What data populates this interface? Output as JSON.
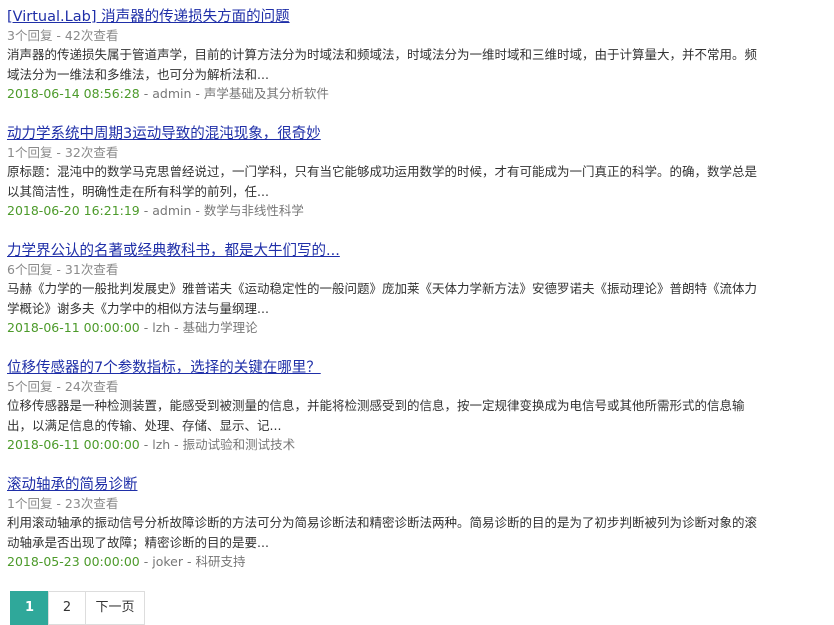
{
  "results": [
    {
      "title": "[Virtual.Lab] 消声器的传递损失方面的问题",
      "meta": "3个回复 - 42次查看",
      "snippet": "消声器的传递损失属于管道声学，目前的计算方法分为时域法和频域法，时域法分为一维时域和三维时域，由于计算量大，并不常用。频域法分为一维法和多维法，也可分为解析法和...",
      "date": "2018-06-14 08:56:28",
      "author": "admin",
      "category": "声学基础及其分析软件"
    },
    {
      "title": "动力学系统中周期3运动导致的混沌现象，很奇妙",
      "meta": "1个回复 - 32次查看",
      "snippet": "原标题：混沌中的数学马克思曾经说过，一门学科，只有当它能够成功运用数学的时候，才有可能成为一门真正的科学。的确，数学总是以其简洁性，明确性走在所有科学的前列，任...",
      "date": "2018-06-20 16:21:19",
      "author": "admin",
      "category": "数学与非线性科学"
    },
    {
      "title": "力学界公认的名著或经典教科书，都是大牛们写的...",
      "meta": "6个回复 - 31次查看",
      "snippet": "马赫《力学的一般批判发展史》雅普诺夫《运动稳定性的一般问题》庞加莱《天体力学新方法》安德罗诺夫《振动理论》普朗特《流体力学概论》谢多夫《力学中的相似方法与量纲理...",
      "date": "2018-06-11 00:00:00",
      "author": "lzh",
      "category": "基础力学理论"
    },
    {
      "title": "位移传感器的7个参数指标，选择的关键在哪里？",
      "meta": "5个回复 - 24次查看",
      "snippet": "位移传感器是一种检测装置，能感受到被测量的信息，并能将检测感受到的信息，按一定规律变换成为电信号或其他所需形式的信息输出，以满足信息的传输、处理、存储、显示、记...",
      "date": "2018-06-11 00:00:00",
      "author": "lzh",
      "category": "振动试验和测试技术"
    },
    {
      "title": "滚动轴承的简易诊断",
      "meta": "1个回复 - 23次查看",
      "snippet": "利用滚动轴承的振动信号分析故障诊断的方法可分为简易诊断法和精密诊断法两种。简易诊断的目的是为了初步判断被列为诊断对象的滚动轴承是否出现了故障；精密诊断的目的是要...",
      "date": "2018-05-23 00:00:00",
      "author": "joker",
      "category": "科研支持"
    }
  ],
  "separator": " - ",
  "pagination": {
    "current": "1",
    "page2": "2",
    "next": "下一页"
  },
  "colors": {
    "title_link": "#1f2fa8",
    "date": "#4c9a2a",
    "active_page": "#2fa89a"
  }
}
